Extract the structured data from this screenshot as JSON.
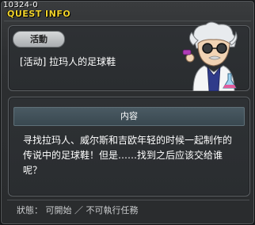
{
  "window": {
    "quest_id": "10324-0",
    "title": "QUEST INFO"
  },
  "quest": {
    "category_label": "活動",
    "name": "[活动] 拉玛人的足球鞋",
    "npc_icon": "scientist-npc-portrait"
  },
  "content": {
    "header": "内容",
    "description": "寻找拉玛人、威尔斯和吉欧年轻的时候一起制作的传说中的足球鞋！但是……找到之后应该交给谁呢？"
  },
  "status": {
    "text": "狀態： 可開始 ／ 不可執行任務"
  }
}
